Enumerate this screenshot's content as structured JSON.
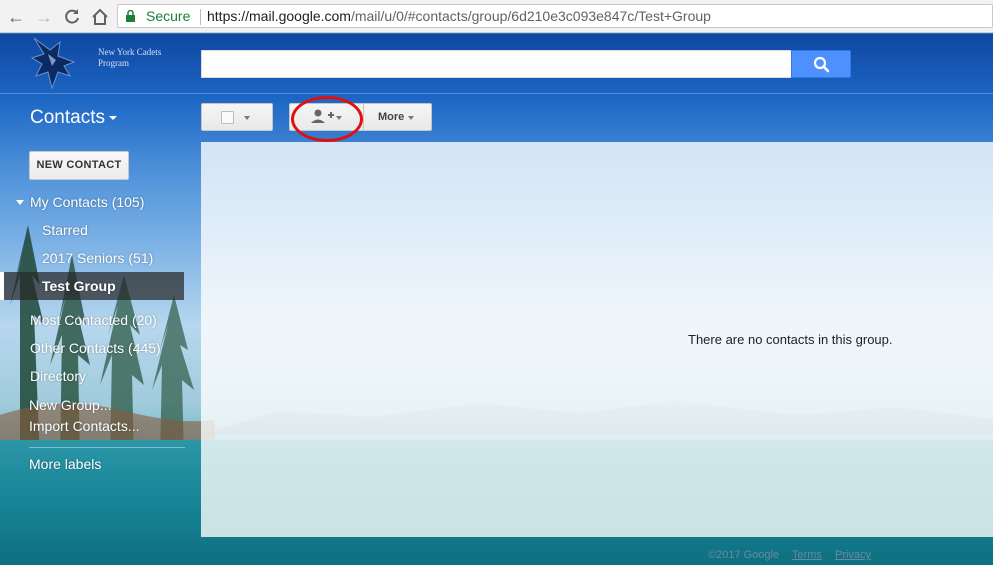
{
  "browser": {
    "secure_label": "Secure",
    "url_host": "https://mail.google.com",
    "url_path": "/mail/u/0/#contacts/group/6d210e3c093e847c/Test+Group"
  },
  "header": {
    "logo_text_line1": "New York Cadets",
    "logo_text_line2": "Program",
    "search_value": "",
    "search_icon": "search-icon"
  },
  "toolbar": {
    "app_title": "Contacts",
    "more_label": "More",
    "add_icon": "add-person-icon"
  },
  "sidebar": {
    "new_contact_label": "NEW CONTACT",
    "my_contacts": "My Contacts (105)",
    "starred": "Starred",
    "seniors": "2017 Seniors (51)",
    "test_group": "Test Group",
    "most_contacted": "Most Contacted (20)",
    "other_contacts": "Other Contacts (445)",
    "directory": "Directory",
    "new_group": "New Group...",
    "import_contacts": "Import Contacts...",
    "more_labels": "More labels"
  },
  "main": {
    "empty_message": "There are no contacts in this group."
  },
  "footer": {
    "copyright": "©2017 Google",
    "terms": "Terms",
    "privacy": "Privacy"
  },
  "colors": {
    "accent_blue": "#4d90fe",
    "annotation_red": "#e01010",
    "secure_green": "#188038"
  }
}
